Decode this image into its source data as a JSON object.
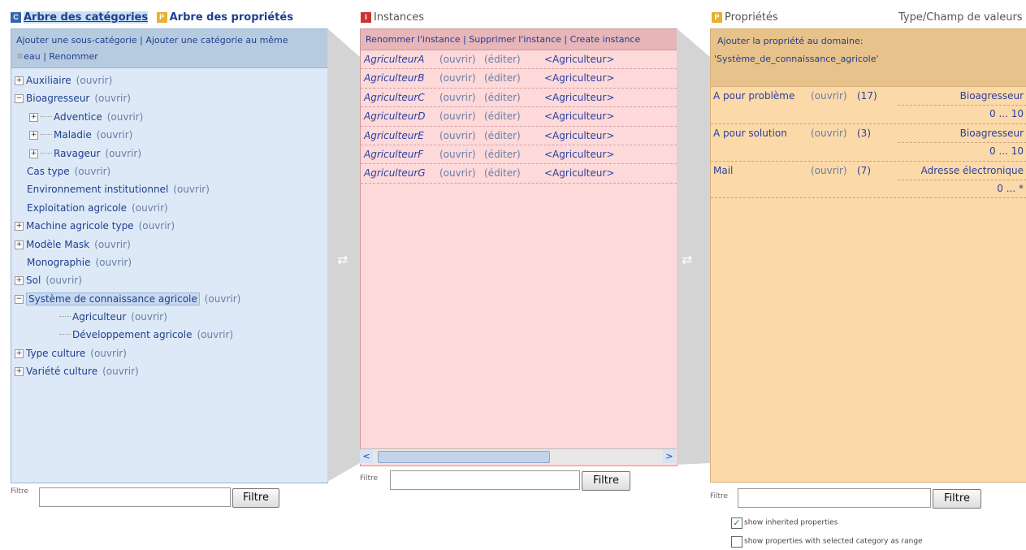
{
  "categories": {
    "tab_categories": "Arbre des catégories",
    "tab_properties": "Arbre des propriétés",
    "badge_c": "C",
    "badge_p": "P",
    "actions_line1": "Ajouter une sous-catégorie | Ajouter une catégorie au même",
    "actions_line2": "eau | Renommer",
    "tree": [
      {
        "label": "Auxiliaire",
        "open": "(ouvrir)",
        "expander": "+"
      },
      {
        "label": "Bioagresseur",
        "open": "(ouvrir)",
        "expander": "−"
      },
      {
        "label": "Adventice",
        "open": "(ouvrir)",
        "expander": "+"
      },
      {
        "label": "Maladie",
        "open": "(ouvrir)",
        "expander": "+"
      },
      {
        "label": "Ravageur",
        "open": "(ouvrir)",
        "expander": "+"
      },
      {
        "label": "Cas type",
        "open": "(ouvrir)",
        "expander": ""
      },
      {
        "label": "Environnement institutionnel",
        "open": "(ouvrir)",
        "expander": ""
      },
      {
        "label": "Exploitation agricole",
        "open": "(ouvrir)",
        "expander": ""
      },
      {
        "label": "Machine agricole type",
        "open": "(ouvrir)",
        "expander": "+"
      },
      {
        "label": "Modèle Mask",
        "open": "(ouvrir)",
        "expander": "+"
      },
      {
        "label": "Monographie",
        "open": "(ouvrir)",
        "expander": ""
      },
      {
        "label": "Sol",
        "open": "(ouvrir)",
        "expander": "+"
      },
      {
        "label": "Système de connaissance agricole",
        "open": "(ouvrir)",
        "expander": "−",
        "selected": true
      },
      {
        "label": "Agriculteur",
        "open": "(ouvrir)",
        "expander": ""
      },
      {
        "label": "Développement agricole",
        "open": "(ouvrir)",
        "expander": ""
      },
      {
        "label": "Type culture",
        "open": "(ouvrir)",
        "expander": "+"
      },
      {
        "label": "Variété culture",
        "open": "(ouvrir)",
        "expander": "+"
      }
    ],
    "filter_label": "Filtre",
    "filter_button": "Filtre"
  },
  "instances": {
    "title": "Instances",
    "badge": "I",
    "actions": "Renommer l'instance | Supprimer l'instance | Create instance",
    "rows": [
      {
        "name": "AgriculteurA",
        "open": "(ouvrir)",
        "edit": "(éditer)",
        "class": "<Agriculteur>"
      },
      {
        "name": "AgriculteurB",
        "open": "(ouvrir)",
        "edit": "(éditer)",
        "class": "<Agriculteur>"
      },
      {
        "name": "AgriculteurC",
        "open": "(ouvrir)",
        "edit": "(éditer)",
        "class": "<Agriculteur>"
      },
      {
        "name": "AgriculteurD",
        "open": "(ouvrir)",
        "edit": "(éditer)",
        "class": "<Agriculteur>"
      },
      {
        "name": "AgriculteurE",
        "open": "(ouvrir)",
        "edit": "(éditer)",
        "class": "<Agriculteur>"
      },
      {
        "name": "AgriculteurF",
        "open": "(ouvrir)",
        "edit": "(éditer)",
        "class": "<Agriculteur>"
      },
      {
        "name": "AgriculteurG",
        "open": "(ouvrir)",
        "edit": "(éditer)",
        "class": "<Agriculteur>"
      }
    ],
    "scroll_left": "<",
    "scroll_right": ">",
    "filter_label": "Filtre",
    "filter_button": "Filtre"
  },
  "properties": {
    "title": "Propriétés",
    "badge": "P",
    "type_header": "Type/Champ de valeurs",
    "actions_line1": "Ajouter la propriété au domaine:",
    "actions_line2": "'Système_de_connaissance_agricole'",
    "rows": [
      {
        "name": "A pour problème",
        "open": "(ouvrir)",
        "count": "(17)",
        "range": "Bioagresseur",
        "card": "0 ... 10"
      },
      {
        "name": "A pour solution",
        "open": "(ouvrir)",
        "count": "(3)",
        "range": "Bioagresseur",
        "card": "0 ... 10"
      },
      {
        "name": "Mail",
        "open": "(ouvrir)",
        "count": "(7)",
        "range": "Adresse électronique",
        "card": "0 ... *"
      }
    ],
    "filter_label": "Filtre",
    "filter_button": "Filtre",
    "show_inherited": "show inherited properties",
    "show_inherited_checked": true,
    "show_range": "show properties with selected category as range",
    "show_range_checked": false,
    "check_mark": "✓"
  },
  "colors": {
    "categories_bg": "#dde9f6",
    "instances_bg": "#fdd9da",
    "properties_bg": "#fcd9a8"
  }
}
